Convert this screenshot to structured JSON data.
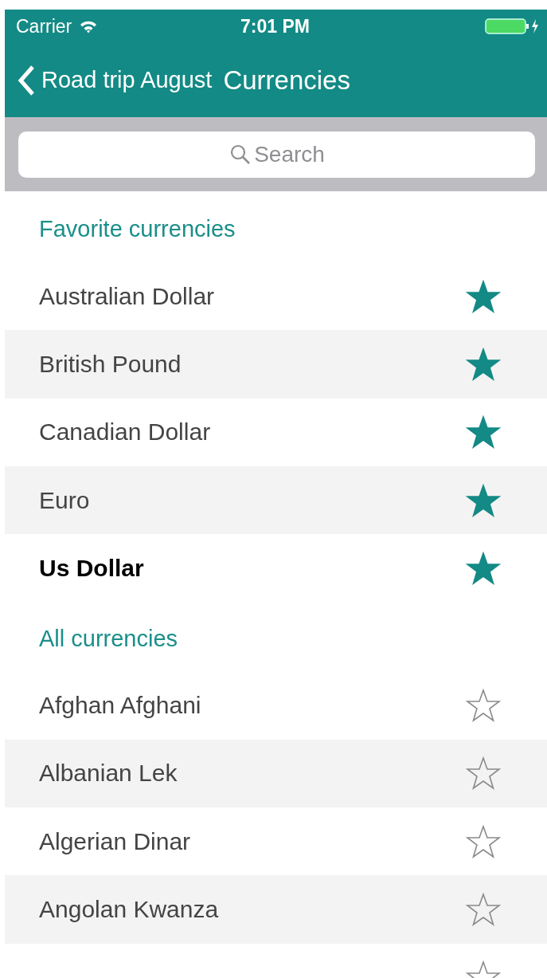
{
  "status_bar": {
    "carrier": "Carrier",
    "time": "7:01 PM"
  },
  "nav": {
    "back_label": "Road trip August",
    "title": "Currencies"
  },
  "search": {
    "placeholder": "Search"
  },
  "sections": [
    {
      "title": "Favorite currencies",
      "rows": [
        {
          "name": "Australian Dollar",
          "favorite": true,
          "selected": false
        },
        {
          "name": "British Pound",
          "favorite": true,
          "selected": false
        },
        {
          "name": "Canadian Dollar",
          "favorite": true,
          "selected": false
        },
        {
          "name": "Euro",
          "favorite": true,
          "selected": false
        },
        {
          "name": "Us Dollar",
          "favorite": true,
          "selected": true
        }
      ]
    },
    {
      "title": "All currencies",
      "rows": [
        {
          "name": "Afghan Afghani",
          "favorite": false,
          "selected": false
        },
        {
          "name": "Albanian Lek",
          "favorite": false,
          "selected": false
        },
        {
          "name": "Algerian Dinar",
          "favorite": false,
          "selected": false
        },
        {
          "name": "Angolan Kwanza",
          "favorite": false,
          "selected": false
        },
        {
          "favorite": false
        }
      ]
    }
  ]
}
